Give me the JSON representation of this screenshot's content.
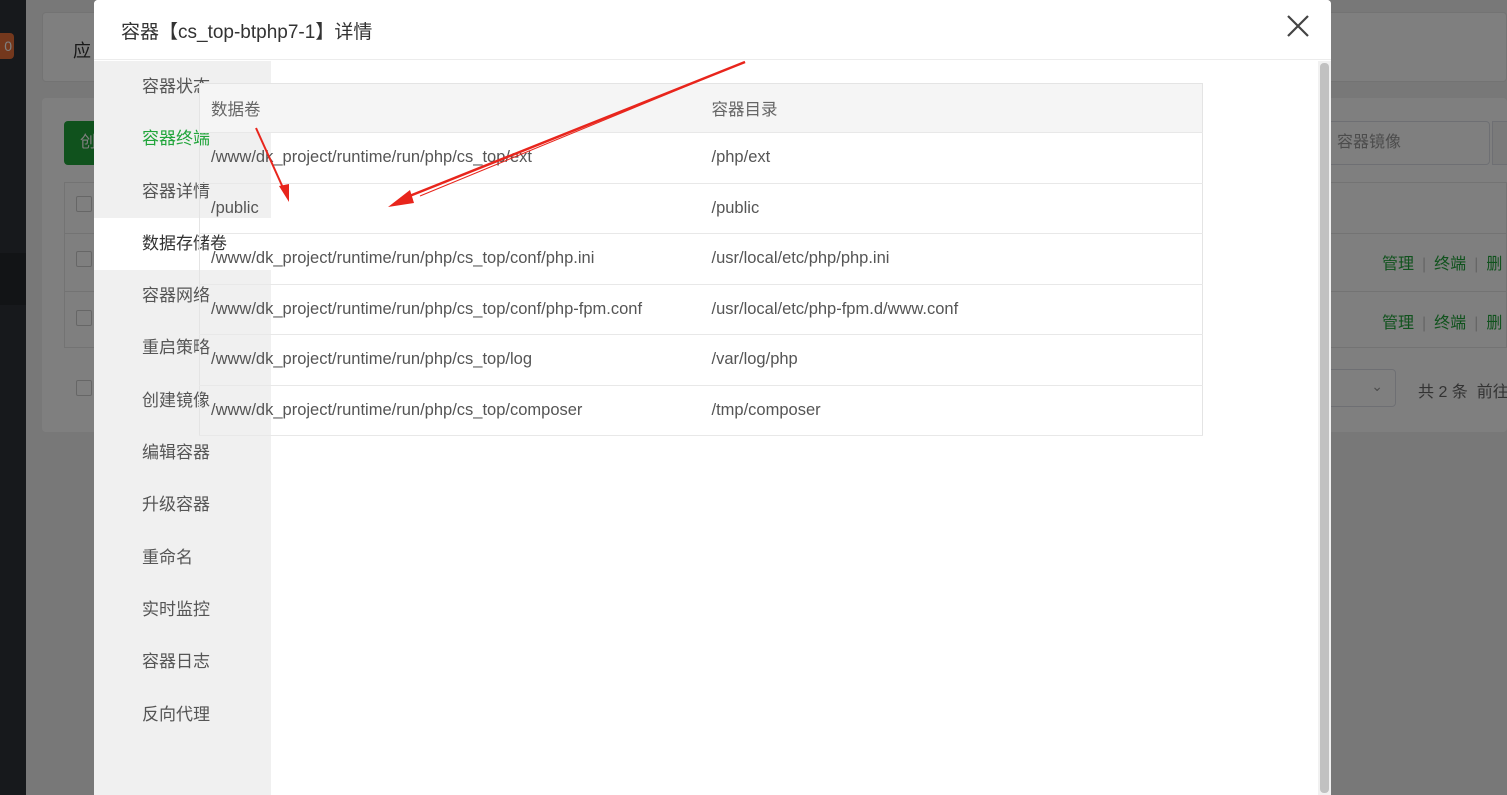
{
  "background": {
    "sidebar_badge": "0",
    "top_card_title": "应",
    "create_button": "创",
    "search_placeholder": "、容器镜像",
    "row_actions": [
      {
        "manage": "管理",
        "terminal": "终端",
        "delete": "删"
      },
      {
        "manage": "管理",
        "terminal": "终端",
        "delete": "删"
      }
    ],
    "pager_total": "共 2 条",
    "pager_goto": "前往"
  },
  "modal": {
    "title": "容器【cs_top-btphp7-1】详情",
    "close_icon": "close-icon"
  },
  "side_nav": {
    "items": [
      {
        "label": "容器状态"
      },
      {
        "label": "容器终端"
      },
      {
        "label": "容器详情"
      },
      {
        "label": "数据存储卷"
      },
      {
        "label": "容器网络"
      },
      {
        "label": "重启策略"
      },
      {
        "label": "创建镜像"
      },
      {
        "label": "编辑容器"
      },
      {
        "label": "升级容器"
      },
      {
        "label": "重命名"
      },
      {
        "label": "实时监控"
      },
      {
        "label": "容器日志"
      },
      {
        "label": "反向代理"
      }
    ],
    "active_index": 3,
    "highlighted_index": 1
  },
  "volumes_table": {
    "headers": [
      "数据卷",
      "容器目录"
    ],
    "rows": [
      [
        "/www/dk_project/runtime/run/php/cs_top/ext",
        "/php/ext"
      ],
      [
        "/public",
        "/public"
      ],
      [
        "/www/dk_project/runtime/run/php/cs_top/conf/php.ini",
        "/usr/local/etc/php/php.ini"
      ],
      [
        "/www/dk_project/runtime/run/php/cs_top/conf/php-fpm.conf",
        "/usr/local/etc/php-fpm.d/www.conf"
      ],
      [
        "/www/dk_project/runtime/run/php/cs_top/log",
        "/var/log/php"
      ],
      [
        "/www/dk_project/runtime/run/php/cs_top/composer",
        "/tmp/composer"
      ]
    ]
  },
  "colors": {
    "accent_green": "#20a53a",
    "annotation_red": "#e8251c",
    "badge_orange": "#e8703a"
  }
}
